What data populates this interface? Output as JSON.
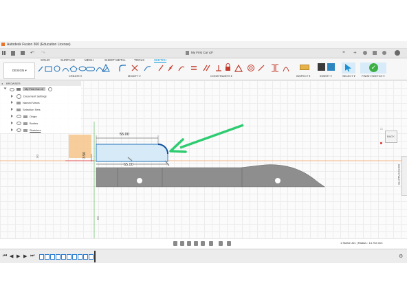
{
  "app": {
    "title": "Autodesk Fusion 360 (Education License)",
    "doc_title": "My First Car v2*"
  },
  "tabs": [
    "SOLID",
    "SURFACE",
    "MESH",
    "SHEET METAL",
    "TOOLS",
    "SKETCH"
  ],
  "active_tab": "SKETCH",
  "ribbon": {
    "workspace": "DESIGN ▾",
    "groups": [
      "CREATE ▾",
      "MODIFY ▾",
      "CONSTRAINTS ▾",
      "INSPECT ▾",
      "INSERT ▾",
      "SELECT ▾",
      "FINISH SKETCH ▾"
    ]
  },
  "browser": {
    "title": "BROWSER",
    "root": "My First Car v2",
    "items": [
      "Document Settings",
      "Named Views",
      "Selection Sets",
      "Origin",
      "Bodies",
      "Sketches"
    ]
  },
  "sketch": {
    "dim_top": "55.00",
    "dim_bottom": "65.00",
    "dim_vertical": "3.50",
    "axis_50_a": "50",
    "axis_50_b": "50"
  },
  "viewcube": "BACK",
  "palette": "SKETCH PALETTE",
  "comments": "COMMENTS",
  "status": "1 Sketch Arc | Radius : 14.754 mm",
  "colors": {
    "accent": "#0696d7",
    "arrow": "#2ecc71",
    "finish": "#3cb043",
    "sketch_line": "#1c6fb8",
    "body": "#8e8e8e",
    "origin_plane": "#f5c890",
    "axis_red": "#e05050",
    "axis_orange": "#f0a060"
  }
}
